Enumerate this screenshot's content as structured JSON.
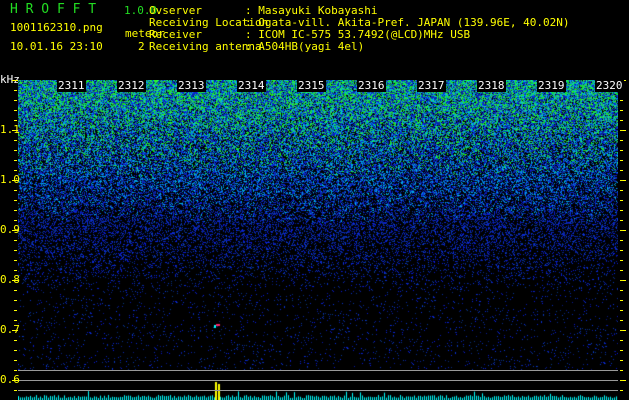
{
  "app": {
    "title": "H R O F F T",
    "version": "1.0.0"
  },
  "file": {
    "name": "1001162310.png",
    "datetime": "10.01.16 23:10"
  },
  "meteor": {
    "label": "meteor",
    "count": "2"
  },
  "info": [
    {
      "label": "Ovserver",
      "value": ": Masayuki Kobayashi"
    },
    {
      "label": "Receiving Location",
      "value": ": Ogata-vill. Akita-Pref. JAPAN (139.96E, 40.02N)"
    },
    {
      "label": "Receiver",
      "value": ": ICOM IC-575 53.7492(@LCD)MHz USB"
    },
    {
      "label": "Receiving antenna",
      "value": ": A504HB(yagi 4el)"
    }
  ],
  "axis": {
    "unit": "kHz",
    "y_labels": [
      "1.1",
      "1.0",
      "0.9",
      "0.8",
      "0.7",
      "0.6"
    ],
    "time_labels": [
      "2311",
      "2312",
      "2313",
      "2314",
      "2315",
      "2316",
      "2317",
      "2318",
      "2319",
      "2320"
    ]
  },
  "colors": {
    "text": "#ffff00",
    "title": "#22dd22",
    "level_bars": "#00ffff",
    "meteor_bar": "#ffff00"
  }
}
